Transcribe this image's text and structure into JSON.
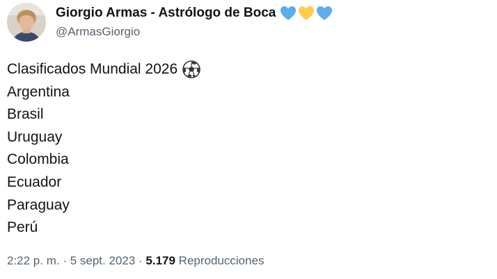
{
  "author": {
    "display_name": "Giorgio Armas - Astrólogo de Boca",
    "handle": "@ArmasGiorgio",
    "emoji_hearts": [
      "blue-heart",
      "yellow-heart",
      "blue-heart"
    ],
    "heart_colors": [
      "#5dadec",
      "#ffcc4d",
      "#5dadec"
    ]
  },
  "tweet": {
    "title": "Clasificados Mundial 2026",
    "title_emoji": "soccer-ball",
    "countries": [
      "Argentina",
      "Brasil",
      "Uruguay",
      "Colombia",
      "Ecuador",
      "Paraguay",
      "Perú"
    ]
  },
  "meta": {
    "time": "2:22 p. m.",
    "separator1": " · ",
    "date": "5 sept. 2023",
    "separator2": " · ",
    "views_count": "5.179",
    "views_label": " Reproducciones"
  },
  "colors": {
    "text": "#0f1419",
    "secondary": "#536471"
  }
}
